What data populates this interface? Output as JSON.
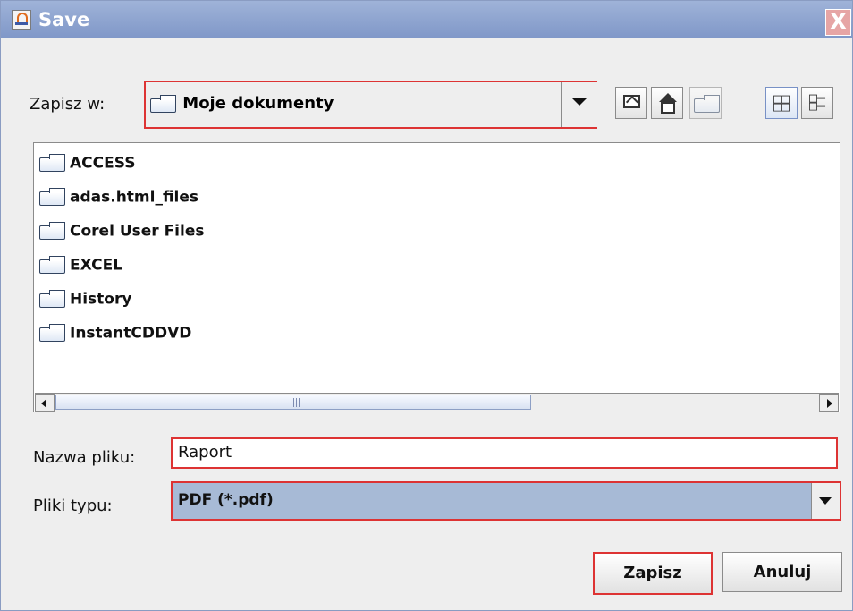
{
  "dialog": {
    "title": "Save",
    "close_label": "X"
  },
  "save_in": {
    "label": "Zapisz w:",
    "selected": "Moje dokumenty"
  },
  "toolbar": {
    "buttons": [
      {
        "icon": "up-one-level-icon"
      },
      {
        "icon": "home-icon"
      },
      {
        "icon": "new-folder-icon"
      },
      {
        "icon": "list-view-icon"
      },
      {
        "icon": "details-view-icon"
      }
    ]
  },
  "files": [
    {
      "name": "ACCESS"
    },
    {
      "name": "adas.html_files"
    },
    {
      "name": "Corel User Files"
    },
    {
      "name": "EXCEL"
    },
    {
      "name": "History"
    },
    {
      "name": "InstantCDDVD"
    }
  ],
  "file_name": {
    "label": "Nazwa pliku:",
    "value": "Raport"
  },
  "file_type": {
    "label": "Pliki typu:",
    "selected": "PDF (*.pdf)"
  },
  "actions": {
    "save": "Zapisz",
    "cancel": "Anuluj"
  },
  "colors": {
    "accent_border": "#d33333",
    "title_bar": "#8fa5d2",
    "selection": "#a7bad6"
  }
}
